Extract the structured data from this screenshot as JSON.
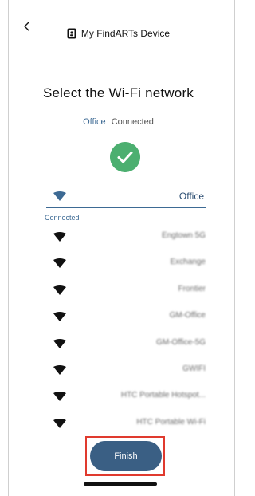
{
  "header": {
    "title": "My FindARTs Device",
    "back_icon": "chevron-left-icon",
    "device_icon": "device-icon"
  },
  "main": {
    "title": "Select the Wi-Fi network",
    "current_network": "Office",
    "status": "Connected",
    "check_icon": "check-circle-icon",
    "selected_network": "Office",
    "connected_label": "Connected",
    "networks": [
      "Engtown 5G",
      "Exchange",
      "Frontier",
      "GM-Office",
      "GM-Office-5G",
      "GWIFI",
      "HTC Portable Hotspot...",
      "HTC Portable Wi-Fi"
    ]
  },
  "footer": {
    "finish_label": "Finish"
  },
  "colors": {
    "accent": "#3a5f84",
    "success": "#4caf70",
    "highlight_box": "#e03a2e"
  }
}
